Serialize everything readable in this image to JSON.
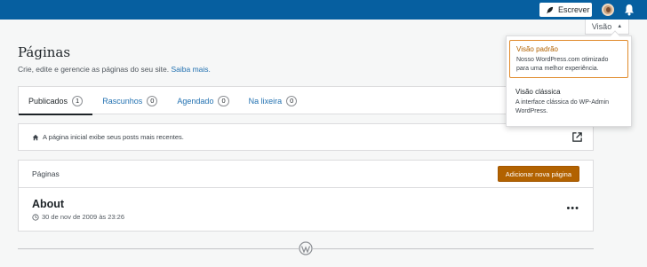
{
  "topbar": {
    "write_label": "Escrever",
    "colors": {
      "bar": "#065fa0"
    }
  },
  "view_switcher": {
    "label": "Visão",
    "options": [
      {
        "title": "Visão padrão",
        "description": "Nosso WordPress.com otimizado para uma melhor experiência.",
        "selected": true
      },
      {
        "title": "Visão clássica",
        "description": "A interface clássica do WP-Admin WordPress.",
        "selected": false
      }
    ]
  },
  "header": {
    "title": "Páginas",
    "subtitle": "Crie, edite e gerencie as páginas do seu site.",
    "learn_more": "Saiba mais."
  },
  "tabs": [
    {
      "label": "Publicados",
      "count": "1",
      "active": true
    },
    {
      "label": "Rascunhos",
      "count": "0",
      "active": false
    },
    {
      "label": "Agendado",
      "count": "0",
      "active": false
    },
    {
      "label": "Na lixeira",
      "count": "0",
      "active": false
    }
  ],
  "notice": {
    "text": "A página inicial exibe seus posts mais recentes."
  },
  "list": {
    "header": "Páginas",
    "add_button": "Adicionar nova página",
    "items": [
      {
        "title": "About",
        "date": "30 de nov de 2009 às 23:26"
      }
    ]
  },
  "icons": [
    "feather-icon",
    "avatar",
    "bell-icon",
    "home-icon",
    "external-link-icon",
    "clock-icon",
    "more-icon",
    "wordpress-logo-icon"
  ],
  "colors": {
    "accent": "#b26200",
    "link": "#2271b1"
  }
}
